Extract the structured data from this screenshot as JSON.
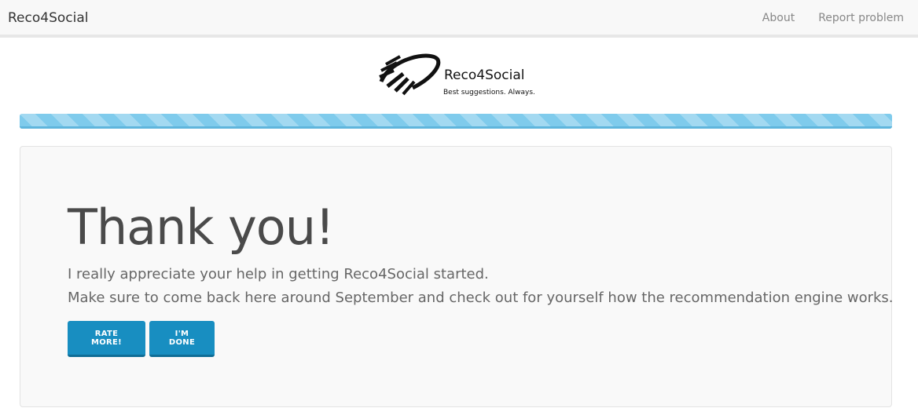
{
  "navbar": {
    "brand": "Reco4Social",
    "links": [
      "About",
      "Report problem"
    ]
  },
  "logo": {
    "title": "Reco4Social",
    "tagline": "Best suggestions. Always."
  },
  "progress": {
    "value_percent": 100,
    "color": "#7fcbec"
  },
  "main": {
    "heading": "Thank you!",
    "line1": "I really appreciate your help in getting Reco4Social started.",
    "line2": "Make sure to come back here around September and check out for yourself how the recommendation engine works.",
    "buttons": {
      "rate_more": "RATE MORE!",
      "done": "I'M DONE"
    }
  },
  "colors": {
    "primary_button": "#188ec1"
  }
}
